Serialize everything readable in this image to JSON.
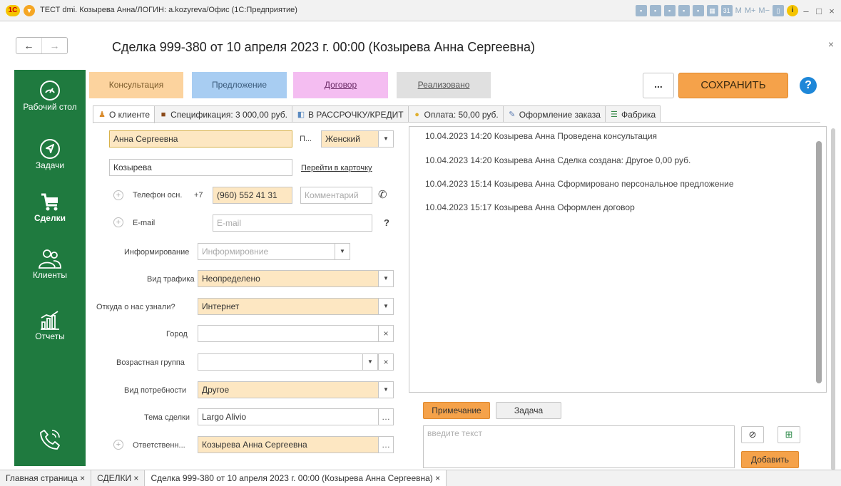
{
  "window": {
    "title": "ТЕСТ dmi. Козырева Анна/ЛОГИН: a.kozyreva/Офис (1С:Предприятие)",
    "tools": [
      "M",
      "M+",
      "M−"
    ]
  },
  "document": {
    "title": "Сделка 999-380 от 10 апреля 2023 г. 00:00 (Козырева Анна Сергеевна)"
  },
  "sidebar": {
    "items": [
      {
        "label": "Рабочий стол",
        "icon": "speedometer-icon"
      },
      {
        "label": "Задачи",
        "icon": "navigation-icon"
      },
      {
        "label": "Сделки",
        "icon": "cart-icon"
      },
      {
        "label": "Клиенты",
        "icon": "users-icon"
      },
      {
        "label": "Отчеты",
        "icon": "chart-icon"
      }
    ]
  },
  "stages": [
    "Консультация",
    "Предложение",
    "Договор",
    "Реализовано"
  ],
  "toolbar": {
    "more": "...",
    "save": "СОХРАНИТЬ",
    "help": "?"
  },
  "tabs": [
    {
      "label": "О клиенте"
    },
    {
      "label": "Спецификация: 3 000,00 руб."
    },
    {
      "label": "В РАССРОЧКУ/КРЕДИТ"
    },
    {
      "label": "Оплата: 50,00 руб."
    },
    {
      "label": "Оформление заказа"
    },
    {
      "label": "Фабрика"
    }
  ],
  "form": {
    "first_name": "Анна Сергеевна",
    "gender_label": "П...",
    "gender": "Женский",
    "last_name": "Козырева",
    "card_link": "Перейти в карточку",
    "phone_label": "Телефон осн.",
    "phone_prefix": "+7",
    "phone": "(960) 552 41 31",
    "comment_placeholder": "Комментарий",
    "email_label": "E-mail",
    "email_placeholder": "E-mail",
    "email_help": "?",
    "info_label": "Информирование",
    "info_placeholder": "Информировние",
    "traffic_label": "Вид трафика",
    "traffic": "Неопределено",
    "source_label": "Откуда о нас узнали?",
    "source": "Интернет",
    "city_label": "Город",
    "city": "",
    "age_label": "Возрастная группа",
    "age": "",
    "need_label": "Вид потребности",
    "need": "Другое",
    "topic_label": "Тема сделки",
    "topic": "Largo Alivio",
    "owner_label": "Ответственн...",
    "owner": "Козырева Анна Сергеевна"
  },
  "history": [
    "10.04.2023 14:20 Козырева Анна  Проведена консультация",
    "10.04.2023 14:20 Козырева Анна  Сделка создана: Другое 0,00 руб.",
    "10.04.2023 15:14 Козырева Анна  Сформировано персональное предложение",
    "10.04.2023 15:17 Козырева Анна  Оформлен договор"
  ],
  "notes": {
    "tab_note": "Примечание",
    "tab_task": "Задача",
    "placeholder": "введите текст",
    "add": "Добавить"
  },
  "taskbar": [
    "Главная страница ×",
    "СДЕЛКИ ×",
    "Сделка 999-380 от 10 апреля 2023 г. 00:00 (Козырева Анна Сергеевна) ×"
  ],
  "colors": {
    "sidebar": "#1f7a3f",
    "accent_orange": "#f5a24a",
    "field_yellow": "#fde7c2",
    "stage_consult": "#fcd39e",
    "stage_offer": "#a8cdf2",
    "stage_contract": "#f4bdf1",
    "stage_done": "#e0e0e0"
  }
}
